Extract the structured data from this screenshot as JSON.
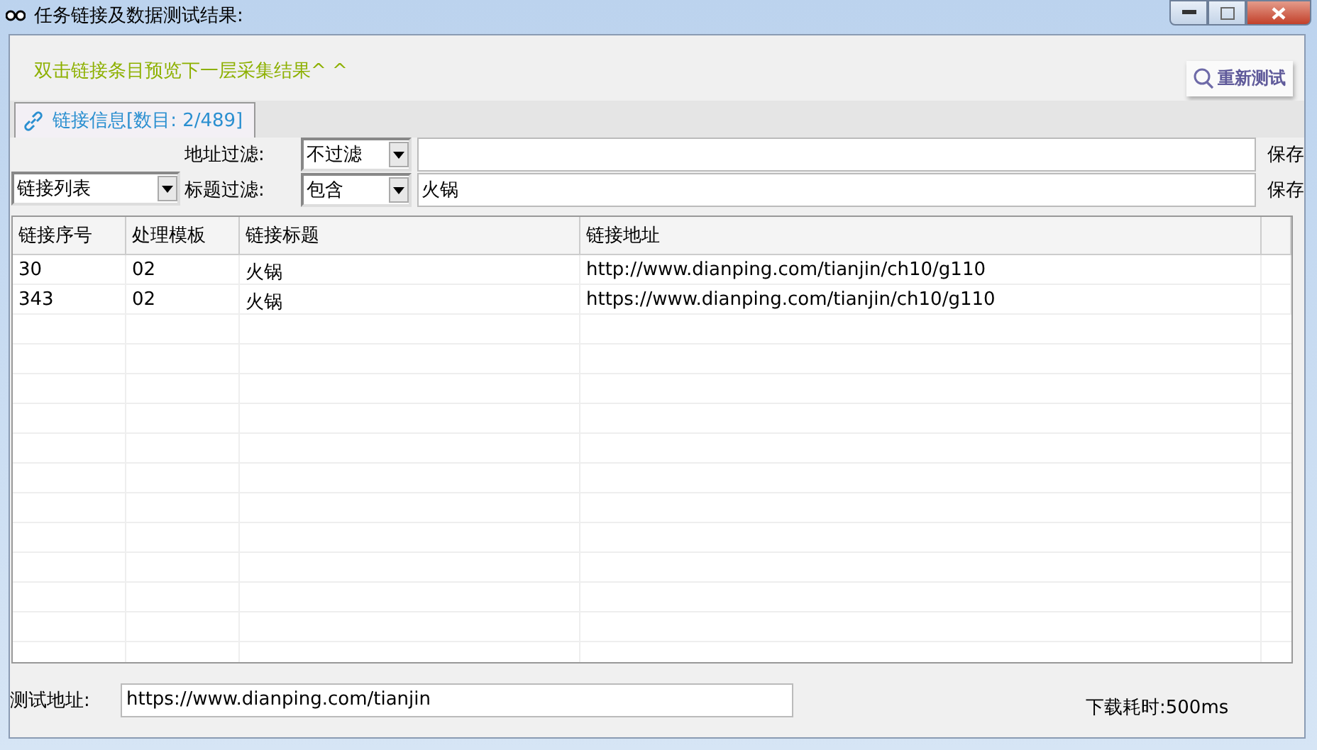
{
  "window": {
    "title": "任务链接及数据测试结果:"
  },
  "hint": "双击链接条目预览下一层采集结果^ ^",
  "retest_button": "重新测试",
  "tabs": [
    {
      "label": "链接信息[数目: 2/489]",
      "selected": true
    }
  ],
  "list_select": {
    "value": "链接列表"
  },
  "filters": [
    {
      "label": "地址过滤:",
      "mode": "不过滤",
      "save": "保存"
    },
    {
      "label": "标题过滤:",
      "mode": "包含",
      "value": "火锅",
      "save": "保存"
    }
  ],
  "table": {
    "columns": [
      "链接序号",
      "处理模板",
      "链接标题",
      "链接地址"
    ],
    "rows": [
      [
        "30",
        "02",
        "火锅",
        "http://www.dianping.com/tianjin/ch10/g110"
      ],
      [
        "343",
        "02",
        "火锅",
        "https://www.dianping.com/tianjin/ch10/g110"
      ]
    ]
  },
  "footer": {
    "label": "测试地址:",
    "url": "https://www.dianping.com/tianjin",
    "timing": "下载耗时:500ms"
  }
}
